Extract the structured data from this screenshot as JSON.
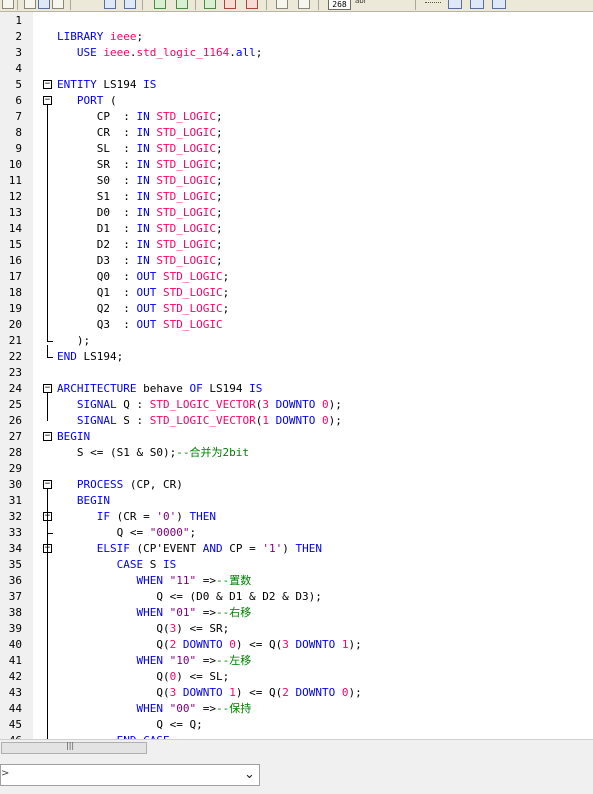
{
  "toolbar": {
    "line_count_badge": "268",
    "badge_suffix": "abl"
  },
  "code_lines": [
    {
      "num": "1",
      "tokens": []
    },
    {
      "num": "2",
      "tokens": [
        [
          "k",
          "LIBRARY"
        ],
        [
          "p",
          " "
        ],
        [
          "n",
          "ieee"
        ],
        [
          "p",
          ";"
        ]
      ]
    },
    {
      "num": "3",
      "tokens": [
        [
          "p",
          "   "
        ],
        [
          "k",
          "USE"
        ],
        [
          "p",
          " "
        ],
        [
          "n",
          "ieee"
        ],
        [
          "p",
          "."
        ],
        [
          "n",
          "std_logic_1164"
        ],
        [
          "p",
          "."
        ],
        [
          "k",
          "all"
        ],
        [
          "p",
          ";"
        ]
      ]
    },
    {
      "num": "4",
      "tokens": []
    },
    {
      "num": "5",
      "tokens": [
        [
          "k",
          "ENTITY"
        ],
        [
          "p",
          " LS194 "
        ],
        [
          "k",
          "IS"
        ]
      ]
    },
    {
      "num": "6",
      "tokens": [
        [
          "p",
          "   "
        ],
        [
          "k",
          "PORT"
        ],
        [
          "p",
          " ("
        ]
      ]
    },
    {
      "num": "7",
      "tokens": [
        [
          "p",
          "      CP  : "
        ],
        [
          "k",
          "IN"
        ],
        [
          "p",
          " "
        ],
        [
          "t",
          "STD_LOGIC"
        ],
        [
          "p",
          ";"
        ]
      ]
    },
    {
      "num": "8",
      "tokens": [
        [
          "p",
          "      CR  : "
        ],
        [
          "k",
          "IN"
        ],
        [
          "p",
          " "
        ],
        [
          "t",
          "STD_LOGIC"
        ],
        [
          "p",
          ";"
        ]
      ]
    },
    {
      "num": "9",
      "tokens": [
        [
          "p",
          "      SL  : "
        ],
        [
          "k",
          "IN"
        ],
        [
          "p",
          " "
        ],
        [
          "t",
          "STD_LOGIC"
        ],
        [
          "p",
          ";"
        ]
      ]
    },
    {
      "num": "10",
      "tokens": [
        [
          "p",
          "      SR  : "
        ],
        [
          "k",
          "IN"
        ],
        [
          "p",
          " "
        ],
        [
          "t",
          "STD_LOGIC"
        ],
        [
          "p",
          ";"
        ]
      ]
    },
    {
      "num": "11",
      "tokens": [
        [
          "p",
          "      S0  : "
        ],
        [
          "k",
          "IN"
        ],
        [
          "p",
          " "
        ],
        [
          "t",
          "STD_LOGIC"
        ],
        [
          "p",
          ";"
        ]
      ]
    },
    {
      "num": "12",
      "tokens": [
        [
          "p",
          "      S1  : "
        ],
        [
          "k",
          "IN"
        ],
        [
          "p",
          " "
        ],
        [
          "t",
          "STD_LOGIC"
        ],
        [
          "p",
          ";"
        ]
      ]
    },
    {
      "num": "13",
      "tokens": [
        [
          "p",
          "      D0  : "
        ],
        [
          "k",
          "IN"
        ],
        [
          "p",
          " "
        ],
        [
          "t",
          "STD_LOGIC"
        ],
        [
          "p",
          ";"
        ]
      ]
    },
    {
      "num": "14",
      "tokens": [
        [
          "p",
          "      D1  : "
        ],
        [
          "k",
          "IN"
        ],
        [
          "p",
          " "
        ],
        [
          "t",
          "STD_LOGIC"
        ],
        [
          "p",
          ";"
        ]
      ]
    },
    {
      "num": "15",
      "tokens": [
        [
          "p",
          "      D2  : "
        ],
        [
          "k",
          "IN"
        ],
        [
          "p",
          " "
        ],
        [
          "t",
          "STD_LOGIC"
        ],
        [
          "p",
          ";"
        ]
      ]
    },
    {
      "num": "16",
      "tokens": [
        [
          "p",
          "      D3  : "
        ],
        [
          "k",
          "IN"
        ],
        [
          "p",
          " "
        ],
        [
          "t",
          "STD_LOGIC"
        ],
        [
          "p",
          ";"
        ]
      ]
    },
    {
      "num": "17",
      "tokens": [
        [
          "p",
          "      Q0  : "
        ],
        [
          "k",
          "OUT"
        ],
        [
          "p",
          " "
        ],
        [
          "t",
          "STD_LOGIC"
        ],
        [
          "p",
          ";"
        ]
      ]
    },
    {
      "num": "18",
      "tokens": [
        [
          "p",
          "      Q1  : "
        ],
        [
          "k",
          "OUT"
        ],
        [
          "p",
          " "
        ],
        [
          "t",
          "STD_LOGIC"
        ],
        [
          "p",
          ";"
        ]
      ]
    },
    {
      "num": "19",
      "tokens": [
        [
          "p",
          "      Q2  : "
        ],
        [
          "k",
          "OUT"
        ],
        [
          "p",
          " "
        ],
        [
          "t",
          "STD_LOGIC"
        ],
        [
          "p",
          ";"
        ]
      ]
    },
    {
      "num": "20",
      "tokens": [
        [
          "p",
          "      Q3  : "
        ],
        [
          "k",
          "OUT"
        ],
        [
          "p",
          " "
        ],
        [
          "t",
          "STD_LOGIC"
        ]
      ]
    },
    {
      "num": "21",
      "tokens": [
        [
          "p",
          "   );"
        ]
      ]
    },
    {
      "num": "22",
      "tokens": [
        [
          "k",
          "END"
        ],
        [
          "p",
          " LS194;"
        ]
      ]
    },
    {
      "num": "23",
      "tokens": []
    },
    {
      "num": "24",
      "tokens": [
        [
          "k",
          "ARCHITECTURE"
        ],
        [
          "p",
          " behave "
        ],
        [
          "k",
          "OF"
        ],
        [
          "p",
          " LS194 "
        ],
        [
          "k",
          "IS"
        ]
      ]
    },
    {
      "num": "25",
      "tokens": [
        [
          "p",
          "   "
        ],
        [
          "k",
          "SIGNAL"
        ],
        [
          "p",
          " Q : "
        ],
        [
          "t",
          "STD_LOGIC_VECTOR"
        ],
        [
          "p",
          "("
        ],
        [
          "n",
          "3"
        ],
        [
          "p",
          " "
        ],
        [
          "k",
          "DOWNTO"
        ],
        [
          "p",
          " "
        ],
        [
          "n",
          "0"
        ],
        [
          "p",
          ");"
        ]
      ]
    },
    {
      "num": "26",
      "tokens": [
        [
          "p",
          "   "
        ],
        [
          "k",
          "SIGNAL"
        ],
        [
          "p",
          " S : "
        ],
        [
          "t",
          "STD_LOGIC_VECTOR"
        ],
        [
          "p",
          "("
        ],
        [
          "n",
          "1"
        ],
        [
          "p",
          " "
        ],
        [
          "k",
          "DOWNTO"
        ],
        [
          "p",
          " "
        ],
        [
          "n",
          "0"
        ],
        [
          "p",
          ");"
        ]
      ]
    },
    {
      "num": "27",
      "tokens": [
        [
          "k",
          "BEGIN"
        ]
      ]
    },
    {
      "num": "28",
      "tokens": [
        [
          "p",
          "   S <= (S1 & S0);"
        ],
        [
          "c",
          "--合并为2bit"
        ]
      ]
    },
    {
      "num": "29",
      "tokens": []
    },
    {
      "num": "30",
      "tokens": [
        [
          "p",
          "   "
        ],
        [
          "k",
          "PROCESS"
        ],
        [
          "p",
          " (CP, CR)"
        ]
      ]
    },
    {
      "num": "31",
      "tokens": [
        [
          "p",
          "   "
        ],
        [
          "k",
          "BEGIN"
        ]
      ]
    },
    {
      "num": "32",
      "tokens": [
        [
          "p",
          "      "
        ],
        [
          "k",
          "IF"
        ],
        [
          "p",
          " (CR = "
        ],
        [
          "s",
          "'0'"
        ],
        [
          "p",
          ") "
        ],
        [
          "k",
          "THEN"
        ]
      ]
    },
    {
      "num": "33",
      "tokens": [
        [
          "p",
          "         Q <= "
        ],
        [
          "s",
          "\"0000\""
        ],
        [
          "p",
          ";"
        ]
      ]
    },
    {
      "num": "34",
      "tokens": [
        [
          "p",
          "      "
        ],
        [
          "k",
          "ELSIF"
        ],
        [
          "p",
          " (CP'EVENT "
        ],
        [
          "k",
          "AND"
        ],
        [
          "p",
          " CP = "
        ],
        [
          "s",
          "'1'"
        ],
        [
          "p",
          ") "
        ],
        [
          "k",
          "THEN"
        ]
      ]
    },
    {
      "num": "35",
      "tokens": [
        [
          "p",
          "         "
        ],
        [
          "k",
          "CASE"
        ],
        [
          "p",
          " S "
        ],
        [
          "k",
          "IS"
        ]
      ]
    },
    {
      "num": "36",
      "tokens": [
        [
          "p",
          "            "
        ],
        [
          "k",
          "WHEN"
        ],
        [
          "p",
          " "
        ],
        [
          "s",
          "\"11\""
        ],
        [
          "p",
          " =>"
        ],
        [
          "c",
          "--置数"
        ]
      ]
    },
    {
      "num": "37",
      "tokens": [
        [
          "p",
          "               Q <= (D0 & D1 & D2 & D3);"
        ]
      ]
    },
    {
      "num": "38",
      "tokens": [
        [
          "p",
          "            "
        ],
        [
          "k",
          "WHEN"
        ],
        [
          "p",
          " "
        ],
        [
          "s",
          "\"01\""
        ],
        [
          "p",
          " =>"
        ],
        [
          "c",
          "--右移"
        ]
      ]
    },
    {
      "num": "39",
      "tokens": [
        [
          "p",
          "               Q("
        ],
        [
          "n",
          "3"
        ],
        [
          "p",
          ") <= SR;"
        ]
      ]
    },
    {
      "num": "40",
      "tokens": [
        [
          "p",
          "               Q("
        ],
        [
          "n",
          "2"
        ],
        [
          "p",
          " "
        ],
        [
          "k",
          "DOWNTO"
        ],
        [
          "p",
          " "
        ],
        [
          "n",
          "0"
        ],
        [
          "p",
          ") <= Q("
        ],
        [
          "n",
          "3"
        ],
        [
          "p",
          " "
        ],
        [
          "k",
          "DOWNTO"
        ],
        [
          "p",
          " "
        ],
        [
          "n",
          "1"
        ],
        [
          "p",
          ");"
        ]
      ]
    },
    {
      "num": "41",
      "tokens": [
        [
          "p",
          "            "
        ],
        [
          "k",
          "WHEN"
        ],
        [
          "p",
          " "
        ],
        [
          "s",
          "\"10\""
        ],
        [
          "p",
          " =>"
        ],
        [
          "c",
          "--左移"
        ]
      ]
    },
    {
      "num": "42",
      "tokens": [
        [
          "p",
          "               Q("
        ],
        [
          "n",
          "0"
        ],
        [
          "p",
          ") <= SL;"
        ]
      ]
    },
    {
      "num": "43",
      "tokens": [
        [
          "p",
          "               Q("
        ],
        [
          "n",
          "3"
        ],
        [
          "p",
          " "
        ],
        [
          "k",
          "DOWNTO"
        ],
        [
          "p",
          " "
        ],
        [
          "n",
          "1"
        ],
        [
          "p",
          ") <= Q("
        ],
        [
          "n",
          "2"
        ],
        [
          "p",
          " "
        ],
        [
          "k",
          "DOWNTO"
        ],
        [
          "p",
          " "
        ],
        [
          "n",
          "0"
        ],
        [
          "p",
          ");"
        ]
      ]
    },
    {
      "num": "44",
      "tokens": [
        [
          "p",
          "            "
        ],
        [
          "k",
          "WHEN"
        ],
        [
          "p",
          " "
        ],
        [
          "s",
          "\"00\""
        ],
        [
          "p",
          " =>"
        ],
        [
          "c",
          "--保持"
        ]
      ]
    },
    {
      "num": "45",
      "tokens": [
        [
          "p",
          "               Q <= Q;"
        ]
      ]
    },
    {
      "num": "46",
      "tokens": [
        [
          "p",
          "         "
        ],
        [
          "k",
          "END CASE"
        ]
      ]
    }
  ],
  "status": {
    "combo_prefix": ">"
  },
  "colors": {
    "keyword": "#0000ff",
    "type": "#ff0066",
    "string": "#800080",
    "comment": "#008000"
  }
}
